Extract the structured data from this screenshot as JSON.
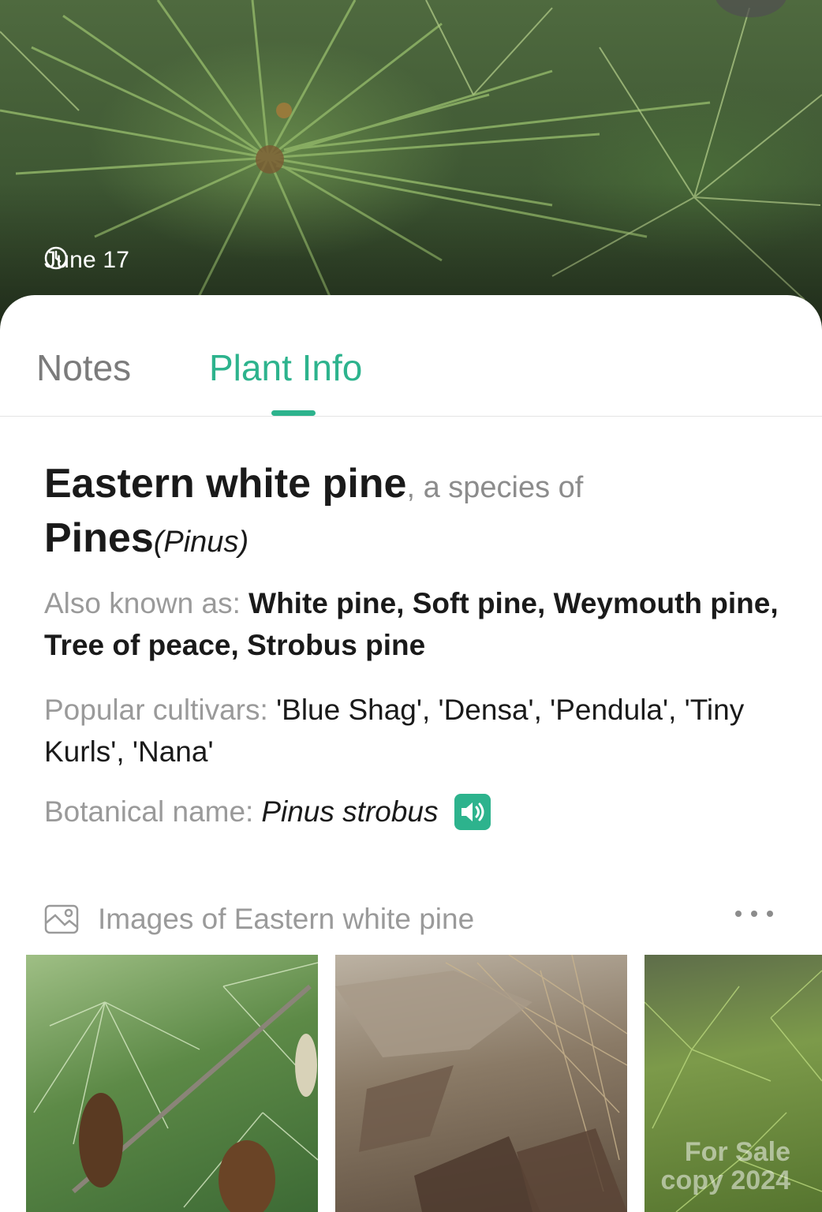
{
  "hero": {
    "date": "June 17",
    "icons": {
      "clock": "clock-icon"
    }
  },
  "tabs": [
    {
      "label": "Notes",
      "active": false
    },
    {
      "label": "Plant Info",
      "active": true
    }
  ],
  "plant": {
    "common_name": "Eastern white pine",
    "species_connector": ", a species of",
    "genus_common": "Pines",
    "genus_latin": "(Pinus)",
    "aka_label": "Also known as:",
    "aka_value": "White pine, Soft pine, Weymouth pine, Tree of peace, Strobus pine",
    "cultivars_label": "Popular cultivars:",
    "cultivars_value": "'Blue Shag', 'Densa', 'Pendula', 'Tiny Kurls', 'Nana'",
    "botanical_label": "Botanical name:",
    "botanical_value": "Pinus strobus",
    "speaker_icon": "speaker-icon"
  },
  "images_section": {
    "title": "Images of Eastern white pine",
    "header_icon": "image-icon",
    "more_icon": "more-icon",
    "watermark_line1": "For Sale",
    "watermark_line2": "copy 2024"
  },
  "colors": {
    "accent": "#2db38d",
    "inactive_tab": "#7b7b7b",
    "label_gray": "#9a9a9a",
    "text": "#1a1a1a"
  }
}
